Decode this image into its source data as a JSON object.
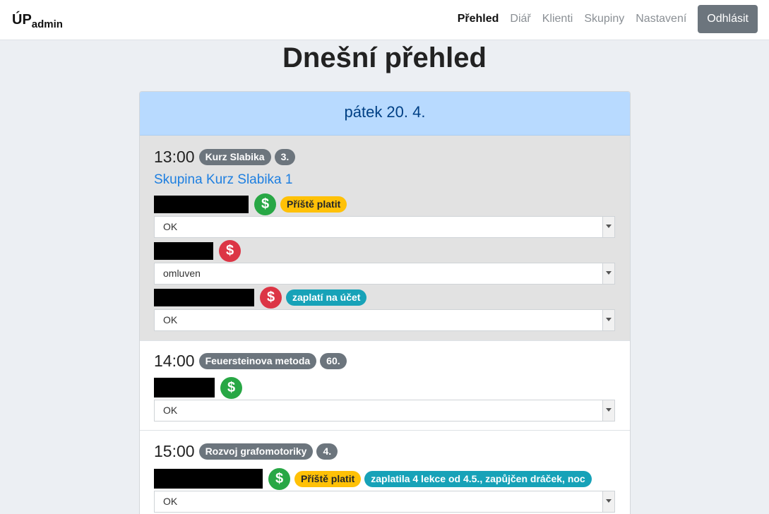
{
  "brand": {
    "main": "ÚP",
    "sub": "admin"
  },
  "nav": {
    "items": [
      "Přehled",
      "Diář",
      "Klienti",
      "Skupiny",
      "Nastavení"
    ],
    "logout": "Odhlásit"
  },
  "page_title": "Dnešní přehled",
  "day": {
    "label": "pátek 20. 4."
  },
  "lessons": [
    {
      "time": "13:00",
      "course": "Kurz Slabika",
      "number": "3.",
      "group": "Skupina Kurz Slabika 1",
      "students": [
        {
          "paid": "green",
          "badges": [
            {
              "text": "Příště platit",
              "color": "yellow"
            }
          ],
          "status": "OK"
        },
        {
          "paid": "red",
          "badges": [],
          "status": "omluven"
        },
        {
          "paid": "red",
          "badges": [
            {
              "text": "zaplatí na účet",
              "color": "teal"
            }
          ],
          "status": "OK"
        }
      ]
    },
    {
      "time": "14:00",
      "course": "Feuersteinova metoda",
      "number": "60.",
      "students": [
        {
          "paid": "green",
          "badges": [],
          "status": "OK"
        }
      ]
    },
    {
      "time": "15:00",
      "course": "Rozvoj grafomotoriky",
      "number": "4.",
      "students": [
        {
          "paid": "green",
          "badges": [
            {
              "text": "Příště platit",
              "color": "yellow"
            },
            {
              "text": "zaplatila 4 lekce od 4.5., zapůjčen dráček, noc",
              "color": "teal"
            }
          ],
          "status": "OK"
        }
      ]
    }
  ],
  "icons": {
    "payment": "dollar-icon",
    "dropdown": "chevron-down-icon"
  },
  "colors": {
    "paid": "#28a745",
    "unpaid": "#dc3545",
    "header_bg": "#b8daff",
    "badge_grey": "#6c757d"
  }
}
